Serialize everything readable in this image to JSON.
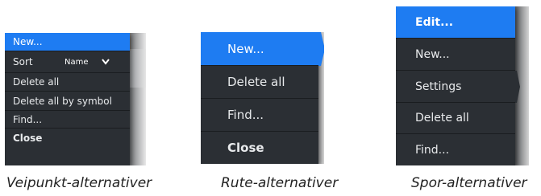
{
  "menus": {
    "waypoint": {
      "items": [
        {
          "label": "New...",
          "selected": true
        },
        {
          "label": "Sort",
          "selected": false
        },
        {
          "label": "Delete all",
          "selected": false
        },
        {
          "label": "Delete all by symbol",
          "selected": false
        },
        {
          "label": "Find...",
          "selected": false
        },
        {
          "label": "Close",
          "selected": false,
          "bold": true
        }
      ],
      "sort_value": "Name",
      "caption": "Veipunkt-alternativer"
    },
    "route": {
      "items": [
        {
          "label": "New...",
          "selected": true
        },
        {
          "label": "Delete all",
          "selected": false
        },
        {
          "label": "Find...",
          "selected": false
        },
        {
          "label": "Close",
          "selected": false,
          "bold": true
        }
      ],
      "caption": "Rute-alternativer"
    },
    "track": {
      "items": [
        {
          "label": "Edit...",
          "selected": true,
          "bold": true
        },
        {
          "label": "New...",
          "selected": false
        },
        {
          "label": "Settings",
          "selected": false
        },
        {
          "label": "Delete all",
          "selected": false
        },
        {
          "label": "Find..."
        }
      ],
      "caption": "Spor-alternativer"
    }
  },
  "colors": {
    "accent": "#1e7cf2",
    "menu_bg": "#2b2f34",
    "text": "#e8eaec"
  }
}
